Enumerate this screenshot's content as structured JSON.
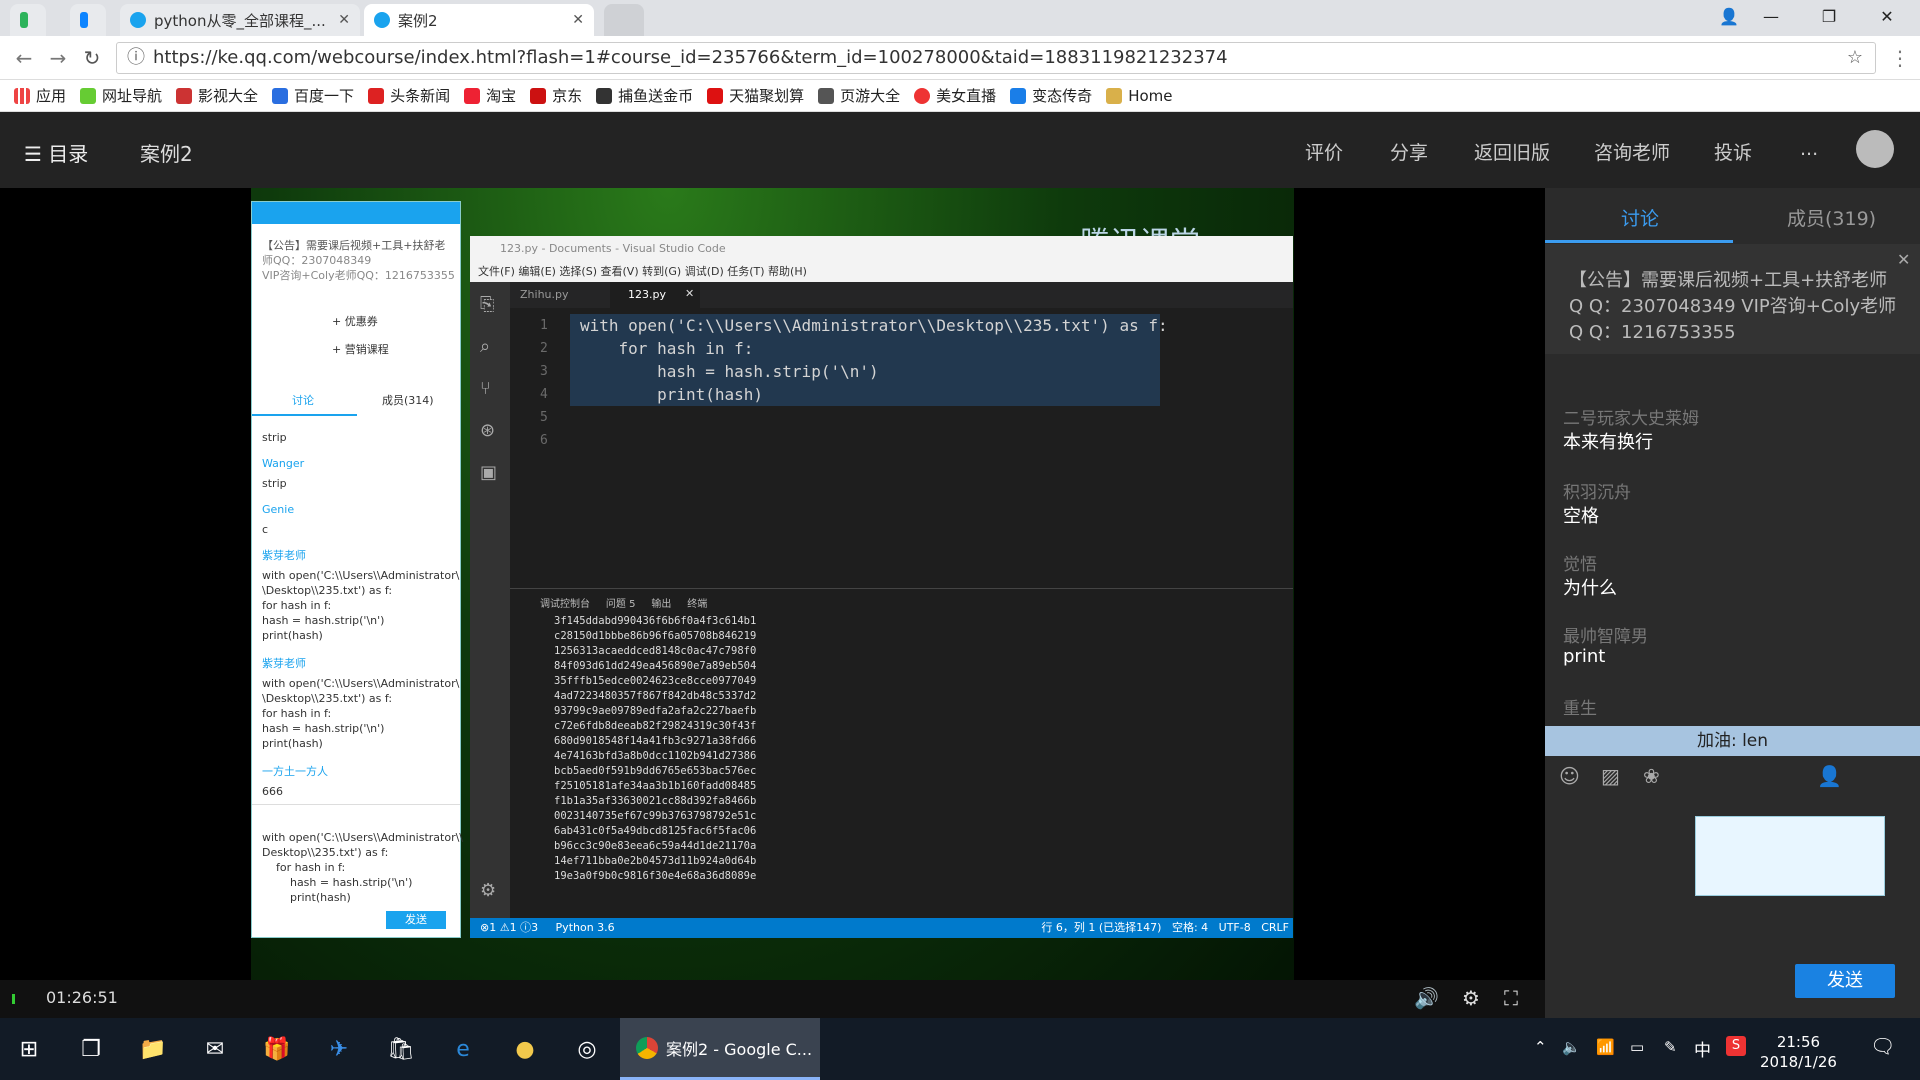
{
  "browser": {
    "tabs": [
      {
        "title": "python从零_全部课程_..."
      },
      {
        "title": "案例2"
      }
    ],
    "url": "https://ke.qq.com/webcourse/index.html?flash=1#course_id=235766&term_id=100278000&taid=1883119821232374",
    "bookmarks": [
      "应用",
      "网址导航",
      "影视大全",
      "百度一下",
      "头条新闻",
      "淘宝",
      "京东",
      "捕鱼送金币",
      "天猫聚划算",
      "页游大全",
      "美女直播",
      "变态传奇",
      "Home"
    ]
  },
  "header": {
    "menu_label": "目录",
    "title": "案例2",
    "links": [
      "评价",
      "分享",
      "返回旧版",
      "咨询老师",
      "投诉",
      "..."
    ]
  },
  "video": {
    "brand": "腾讯课堂",
    "qq_panel": {
      "notice": "【公告】需要课后视频+工具+扶舒老",
      "notice2": "师QQ：2307048349",
      "notice3": "VIP咨询+Coly老师QQ：1216753355",
      "coupon": "+ 优惠券",
      "course": "+ 营销课程",
      "tab_discuss": "讨论",
      "tab_members": "成员(314)",
      "lines": [
        "strip",
        "Wanger",
        "strip",
        "Genie",
        "c",
        "紫芽老师",
        "with open('C:\\\\Users\\\\Administrator\\",
        "\\Desktop\\\\235.txt') as f:",
        "for hash in f:",
        "hash = hash.strip('\\n')",
        "print(hash)",
        "紫芽老师",
        "with open('C:\\\\Users\\\\Administrator\\",
        "\\Desktop\\\\235.txt') as f:",
        "for hash in f:",
        "hash = hash.strip('\\n')",
        "print(hash)",
        "一方土一方人",
        "666"
      ],
      "input_lines": [
        "with open('C:\\\\Users\\\\Administrator\\\\",
        "Desktop\\\\235.txt') as f:",
        "    for hash in f:",
        "        hash = hash.strip('\\n')",
        "        print(hash)"
      ],
      "send": "发送"
    },
    "vscode": {
      "title": "123.py - Documents - Visual Studio Code",
      "menu": "文件(F)  编辑(E)  选择(S)  查看(V)  转到(G)  调试(D)  任务(T)  帮助(H)",
      "tab1": "Zhihu.py",
      "tab2": "123.py",
      "code": [
        "with open('C:\\\\Users\\\\Administrator\\\\Desktop\\\\235.txt') as f:",
        "    for hash in f:",
        "        hash = hash.strip('\\n')",
        "        print(hash)",
        "",
        ""
      ],
      "line_numbers": [
        "1",
        "2",
        "3",
        "4",
        "5",
        "6"
      ],
      "panel_tabs": "调试控制台     问题 5     输出     终端",
      "output": [
        "3f145ddabd990436f6b6f0a4f3c614b1",
        "c28150d1bbbe86b96f6a05708b846219",
        "1256313acaeddced8148c0ac47c798f0",
        "84f093d61dd249ea456890e7a89eb504",
        "35fffb15edce0024623ce8cce0977049",
        "4ad7223480357f867f842db48c5337d2",
        "93799c9ae09789edfa2afa2c227baefb",
        "c72e6fdb8deeab82f29824319c30f43f",
        "680d9018548f14a41fb3c9271a38fd66",
        "4e74163bfd3a8b0dcc1102b941d27386",
        "bcb5aed0f591b9dd6765e653bac576ec",
        "f25105181afe34aa3b1b160fadd08485",
        "f1b1a35af33630021cc88d392fa8466b",
        "0023140735ef67c99b3763798792e51c",
        "6ab431c0f5a49dbcd8125fac6f5fac06",
        "b96cc3c90e83eea6c59a44d1de21170a",
        "14ef711bba0e2b04573d11b924a0d64b",
        "19e3a0f9b0c9816f30e4e68a36d8089e"
      ],
      "status_left": "⊗1 ⚠1 ⓘ3     Python 3.6",
      "status_right": "行 6，列 1 (已选择147)   空格: 4   UTF-8   CRLF"
    }
  },
  "sidebar": {
    "tab_discuss": "讨论",
    "tab_members": "成员(319)",
    "notice": "【公告】需要课后视频+工具+扶舒老师Q Q：2307048349 VIP咨询+Coly老师Q Q：1216753355",
    "messages": [
      {
        "name": "二号玩家大史莱姆",
        "text": "本来有换行"
      },
      {
        "name": "积羽沉舟",
        "text": "空格"
      },
      {
        "name": "觉悟",
        "text": "为什么"
      },
      {
        "name": "最帅智障男",
        "text": "print"
      },
      {
        "name": "重生",
        "text": ""
      }
    ],
    "popup": "加油: len",
    "send": "发送"
  },
  "player": {
    "time": "01:26:51"
  },
  "taskbar": {
    "chrome_label": "案例2 - Google C...",
    "time": "21:56",
    "date": "2018/1/26",
    "ime": "中"
  }
}
